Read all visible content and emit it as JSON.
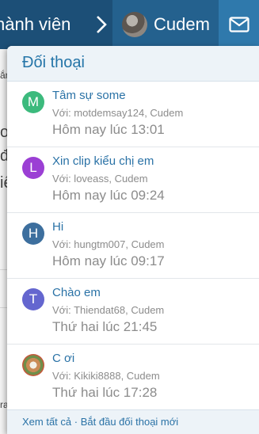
{
  "nav": {
    "members_label": "hành viên",
    "username": "Cudem"
  },
  "background": {
    "fragments": [
      "ắn",
      "o",
      "đ",
      "iế",
      "ra"
    ]
  },
  "conversations": {
    "title": "Đối thoại",
    "items": [
      {
        "initial": "M",
        "color": "#3cba7d",
        "title": "Tâm sự some",
        "with": "Với: motdemsay124, Cudem",
        "time": "Hôm nay lúc 13:01"
      },
      {
        "initial": "L",
        "color": "#9b3fd4",
        "title": "Xin clip kiểu chị em",
        "with": "Với: loveass, Cudem",
        "time": "Hôm nay lúc 09:24"
      },
      {
        "initial": "H",
        "color": "#3d6f9e",
        "title": "Hi",
        "with": "Với: hungtm007, Cudem",
        "time": "Hôm nay lúc 09:17"
      },
      {
        "initial": "T",
        "color": "#6466cf",
        "title": "Chào em",
        "with": "Với: Thiendat68, Cudem",
        "time": "Thứ hai lúc 21:45"
      },
      {
        "initial": "",
        "color": "#c98a55",
        "title": "C ơi",
        "with": "Với: Kikiki8888, Cudem",
        "time": "Thứ hai lúc 17:28"
      }
    ],
    "footer": {
      "view_all": "Xem tất cả",
      "separator": "·",
      "start_new": "Bắt đầu đối thoại mới"
    }
  }
}
